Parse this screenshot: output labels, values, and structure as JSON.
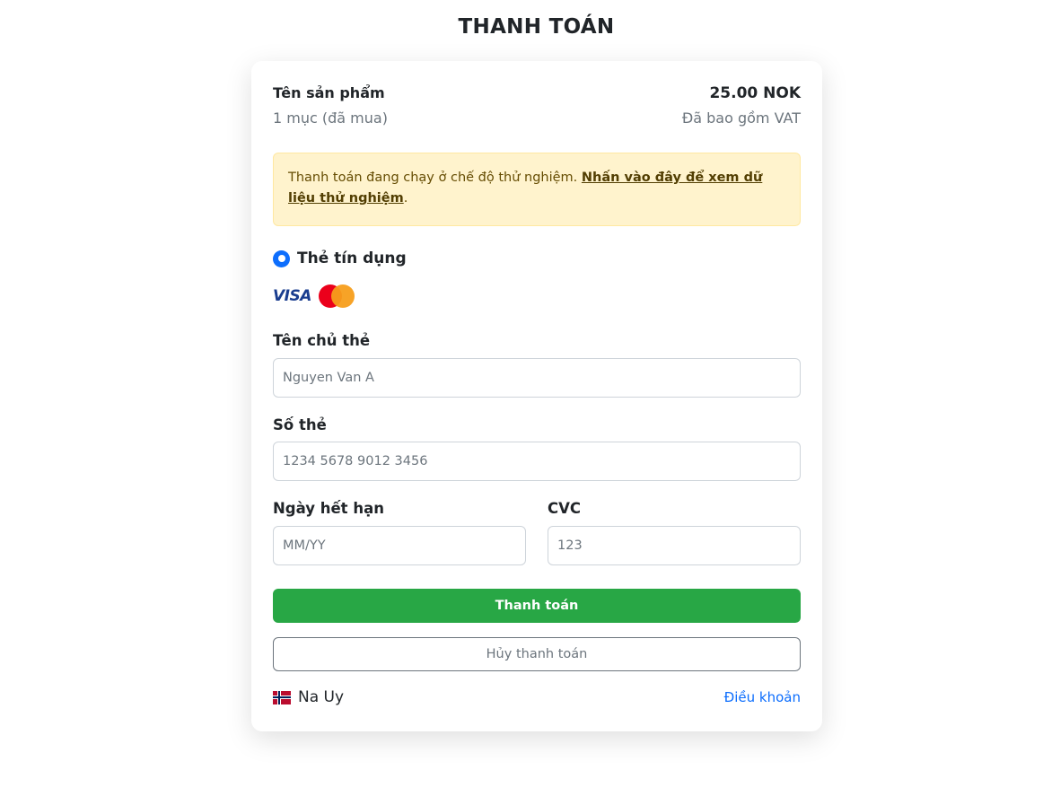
{
  "page": {
    "title": "THANH TOÁN"
  },
  "summary": {
    "product_name": "Tên sản phẩm",
    "price": "25.00 NOK",
    "quantity": "1 mục (đã mua)",
    "vat_note": "Đã bao gồm VAT"
  },
  "alert": {
    "text": "Thanh toán đang chạy ở chế độ thử nghiệm. ",
    "link_text": "Nhấn vào đây để xem dữ liệu thử nghiệm",
    "suffix": "."
  },
  "payment_method": {
    "label": "Thẻ tín dụng",
    "selected": true,
    "brands": [
      "VISA",
      "Mastercard"
    ]
  },
  "form": {
    "holder": {
      "label": "Tên chủ thẻ",
      "placeholder": "Nguyen Van A",
      "value": ""
    },
    "card_number": {
      "label": "Số thẻ",
      "placeholder": "1234 5678 9012 3456",
      "value": ""
    },
    "expiry": {
      "label": "Ngày hết hạn",
      "placeholder": "MM/YY",
      "value": ""
    },
    "cvc": {
      "label": "CVC",
      "placeholder": "123",
      "value": ""
    }
  },
  "actions": {
    "pay_label": "Thanh toán",
    "cancel_label": "Hủy thanh toán"
  },
  "footer": {
    "language": "Na Uy",
    "flag_icon": "norway-flag-icon",
    "terms_link": "Điều khoản"
  },
  "colors": {
    "accent_blue": "#0d6efd",
    "pay_green": "#28a745",
    "alert_bg": "#fff3cd",
    "alert_text": "#664d03"
  }
}
